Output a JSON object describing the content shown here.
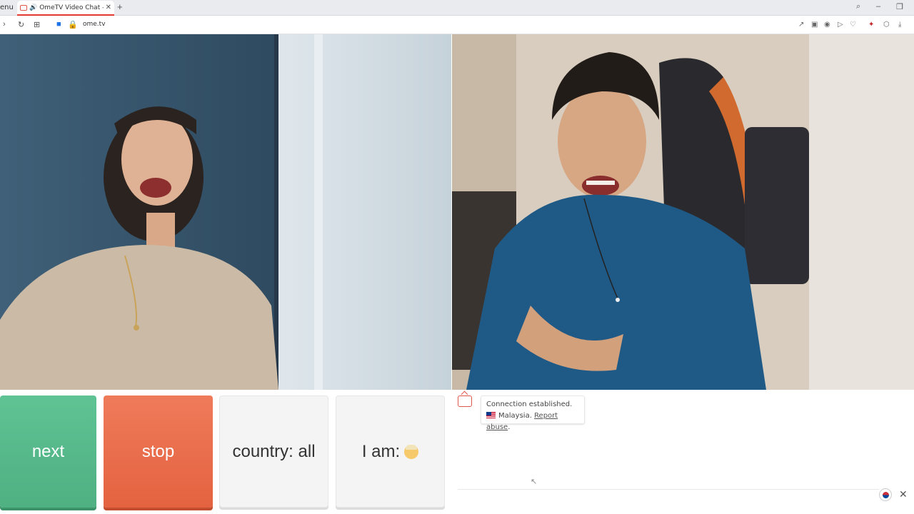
{
  "browser": {
    "menu_label": "enu",
    "tab_title": "OmeTV Video Chat - C",
    "new_tab": "+",
    "url": "ome.tv",
    "icons": [
      "search-icon",
      "minimize-icon",
      "restore-icon",
      "reload-icon",
      "grid-icon",
      "camera-icon",
      "lock-icon",
      "share-icon",
      "screenshot-icon",
      "record-icon",
      "play-icon",
      "heart-icon",
      "extension-icon",
      "cube-icon",
      "download-icon"
    ]
  },
  "controls": {
    "next_label": "next",
    "stop_label": "stop",
    "country_label": "country: all",
    "iam_label": "I am:"
  },
  "chat": {
    "status_text": "Connection established.",
    "country_name": "Malaysia.",
    "report_link": "Report abuse",
    "report_suffix": ".",
    "close_glyph": "✕"
  },
  "colors": {
    "next": "#56b98a",
    "stop": "#e8694a",
    "neutral_button": "#f4f4f4",
    "brand": "#e2574c"
  }
}
